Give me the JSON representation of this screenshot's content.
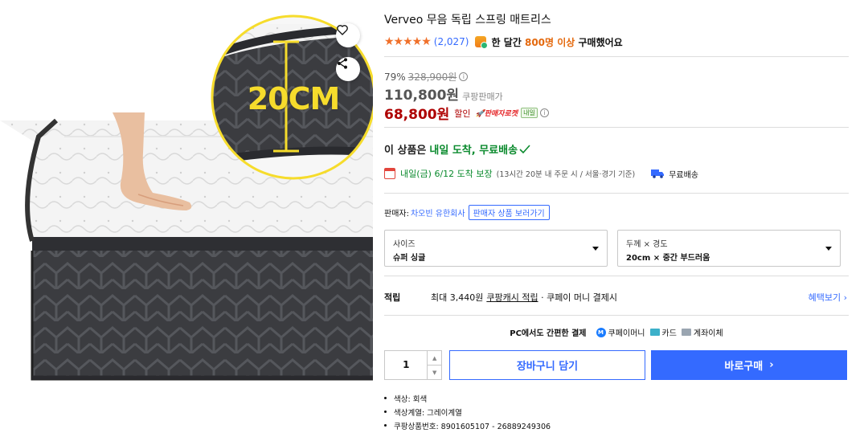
{
  "product": {
    "title": "Verveo 무음 독립 스프링 매트리스",
    "stars": "★★★★★",
    "review_count": "(2,027)",
    "purchase_prefix": "한 달간 ",
    "purchase_count": "800명 이상",
    "purchase_suffix": " 구매했어요"
  },
  "image": {
    "zoom_label": "20CM",
    "wish_icon": "heart-icon",
    "share_icon": "share-icon"
  },
  "price": {
    "discount_rate": "79%",
    "original_price": "328,900원",
    "info_icon": "i",
    "sale_price": "110,800원",
    "sale_label": "쿠팡판매가",
    "final_price": "68,800원",
    "final_label": "할인",
    "rocket_badge": "🚀판매자로켓",
    "next_day_tag": "내일"
  },
  "shipping": {
    "arrival_prefix": "이 상품은",
    "arrival_highlight": "내일 도착, 무료배송",
    "delivery_date": "내일(금) 6/12 도착 보장",
    "delivery_note": "(13시간 20분 내 주문 시 / 서울·경기 기준)",
    "free_shipping": "무료배송"
  },
  "seller": {
    "label": "판매자:",
    "name": "차오빈 유한회사",
    "view_products": "판매자 상품 보러가기"
  },
  "options": [
    {
      "label": "사이즈",
      "value": "슈퍼 싱글"
    },
    {
      "label": "두께 × 경도",
      "value": "20cm × 중간 부드러움"
    }
  ],
  "benefit": {
    "label": "적립",
    "text_prefix": "최대 3,440원",
    "text_link": "쿠팡캐시 적립",
    "text_suffix": "· 쿠페이 머니 결제시",
    "more": "혜택보기 ›"
  },
  "payment": {
    "title": "PC에서도 간편한 결제",
    "coupay_icon": "M",
    "methods": [
      "쿠페이머니",
      "카드",
      "계좌이체"
    ]
  },
  "purchase": {
    "quantity": "1",
    "up_arrow": "▲",
    "down_arrow": "▼",
    "cart_label": "장바구니 담기",
    "buy_label": "바로구매",
    "buy_chevron": "›"
  },
  "attributes": [
    "색상: 회색",
    "색상계열: 그레이계열",
    "쿠팡상품번호: 8901605107 - 26889249306"
  ],
  "colors": {
    "accent": "#346aff",
    "price_red": "#ae0000",
    "star_orange": "#f0702a",
    "green": "#0a8a2d"
  }
}
